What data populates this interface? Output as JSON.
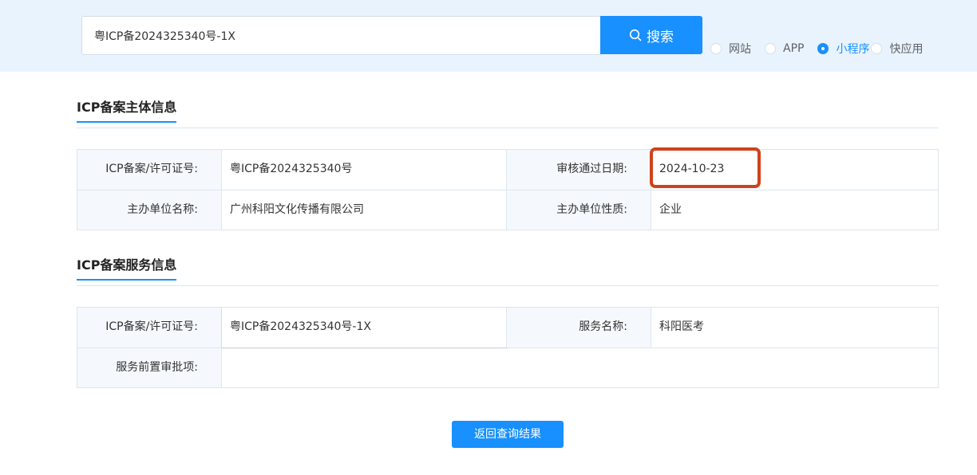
{
  "search": {
    "value": "粤ICP备2024325340号-1X",
    "button_label": "搜索"
  },
  "filter_types": [
    {
      "label": "网站",
      "checked": false
    },
    {
      "label": "APP",
      "checked": false
    },
    {
      "label": "小程序",
      "checked": true
    },
    {
      "label": "快应用",
      "checked": false
    }
  ],
  "subject_info": {
    "title": "ICP备案主体信息",
    "license_label": "ICP备案/许可证号:",
    "license_value": "粤ICP备2024325340号",
    "approval_date_label": "审核通过日期:",
    "approval_date_value": "2024-10-23",
    "org_name_label": "主办单位名称:",
    "org_name_value": "广州科阳文化传播有限公司",
    "org_type_label": "主办单位性质:",
    "org_type_value": "企业"
  },
  "service_info": {
    "title": "ICP备案服务信息",
    "license_label": "ICP备案/许可证号:",
    "license_value": "粤ICP备2024325340号-1X",
    "service_name_label": "服务名称:",
    "service_name_value": "科阳医考",
    "pre_approval_label": "服务前置审批项:",
    "pre_approval_value": ""
  },
  "back_button_label": "返回查询结果",
  "colors": {
    "accent": "#1890ff",
    "highlight": "#d0421b",
    "topbar_bg": "#e8f3fd"
  }
}
